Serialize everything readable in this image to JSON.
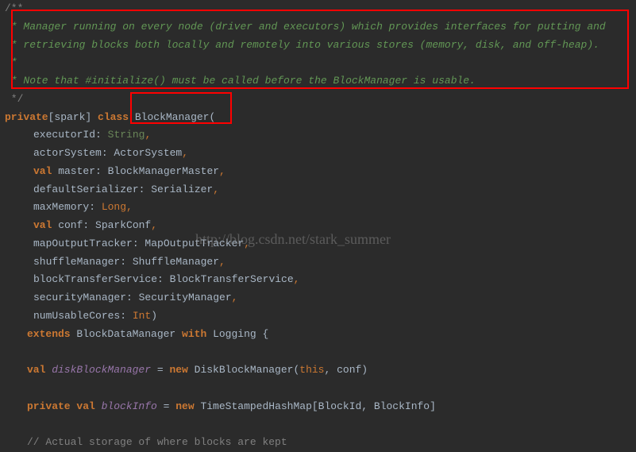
{
  "doc": {
    "open": "/**",
    "line1": " * Manager running on every node (driver and executors) which provides interfaces for putting and",
    "line2": " * retrieving blocks both locally and remotely into various stores (memory, disk, and off-heap).",
    "line3": " *",
    "line4": " * Note that #initialize() must be called before the BlockManager is usable.",
    "close": " */"
  },
  "decl": {
    "kw_private": "private",
    "scope": "[spark]",
    "kw_class": "class",
    "class_name": "BlockManager",
    "open_paren": "("
  },
  "params": {
    "p1_name": "executorId:",
    "p1_type": "String",
    "p1_end": ",",
    "p2_name": "actorSystem: ActorSystem",
    "p2_end": ",",
    "p3_kw": "val",
    "p3_rest": " master: BlockManagerMaster",
    "p3_end": ",",
    "p4_name": "defaultSerializer: Serializer",
    "p4_end": ",",
    "p5_name": "maxMemory: ",
    "p5_type": "Long",
    "p5_end": ",",
    "p6_kw": "val",
    "p6_rest": " conf: SparkConf",
    "p6_end": ",",
    "p7_name": "mapOutputTracker: MapOutputTracker",
    "p7_end": ",",
    "p8_name": "shuffleManager: ShuffleManager",
    "p8_end": ",",
    "p9_name": "blockTransferService: BlockTransferService",
    "p9_end": ",",
    "p10_name": "securityManager: SecurityManager",
    "p10_end": ",",
    "p11_name": "numUsableCores: ",
    "p11_type": "Int",
    "p11_end": ")"
  },
  "extends": {
    "kw_extends": "extends",
    "base": " BlockDataManager ",
    "kw_with": "with",
    "mixin": " Logging {"
  },
  "body": {
    "l1_kw": "val",
    "l1_field": " diskBlockManager",
    "l1_eq": " = ",
    "l1_new": "new",
    "l1_rest": " DiskBlockManager(",
    "l1_this": "this",
    "l1_end": ", conf)",
    "l2_private": "private",
    "l2_val": " val",
    "l2_field": " blockInfo",
    "l2_eq": " = ",
    "l2_new": "new",
    "l2_rest": " TimeStampedHashMap[BlockId, BlockInfo]",
    "comment1": "// Actual storage of where blocks are kept"
  },
  "watermark": "http://blog.csdn.net/stark_summer"
}
